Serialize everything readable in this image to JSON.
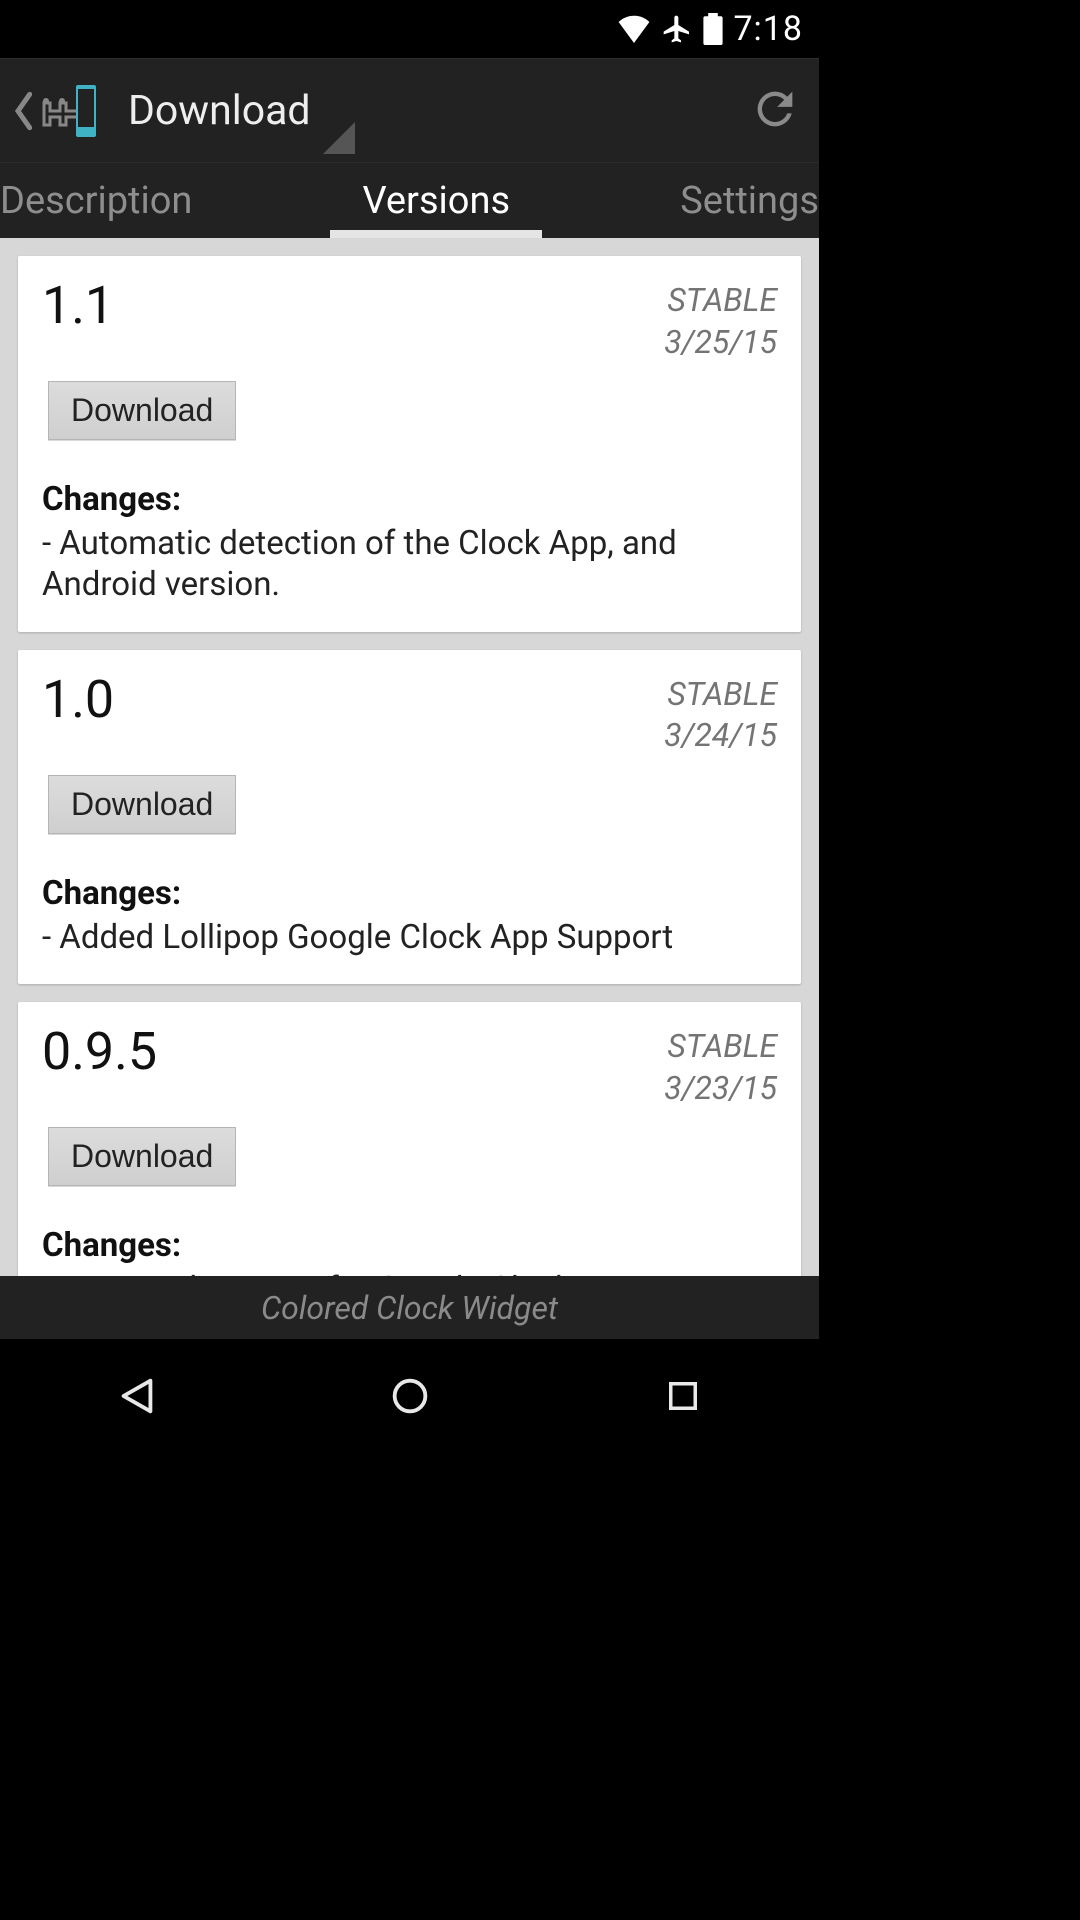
{
  "status": {
    "time": "7:18"
  },
  "actionbar": {
    "title": "Download"
  },
  "tabs": {
    "left": "Description",
    "center": "Versions",
    "right": "Settings"
  },
  "versions": [
    {
      "version": "1.1",
      "stability": "STABLE",
      "date": "3/25/15",
      "download_label": "Download",
      "changes_label": "Changes:",
      "changes": "- Automatic detection of the Clock App, and Android version."
    },
    {
      "version": "1.0",
      "stability": "STABLE",
      "date": "3/24/15",
      "download_label": "Download",
      "changes_label": "Changes:",
      "changes": "- Added Lollipop Google Clock App Support"
    },
    {
      "version": "0.9.5",
      "stability": "STABLE",
      "date": "3/23/15",
      "download_label": "Download",
      "changes_label": "Changes:",
      "changes": "- Improved support for Google Clock App."
    }
  ],
  "module_name": "Colored Clock Widget"
}
